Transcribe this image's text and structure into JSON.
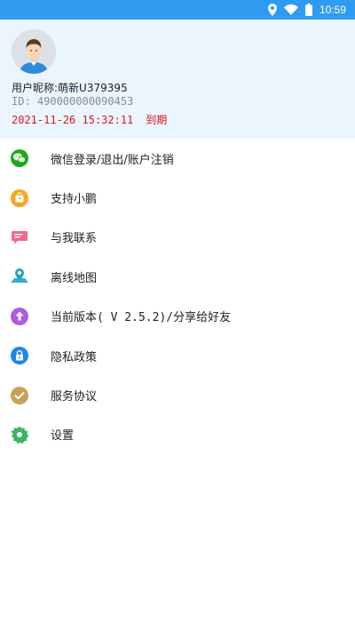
{
  "status_bar": {
    "time": "10:59",
    "color": "#2f9bf0"
  },
  "profile": {
    "nickname_label": "用户昵称:",
    "nickname": "萌新U379395",
    "id_text": "ID: 490000000090453",
    "expire_date": "2021-11-26 15:32:11",
    "expire_status": "到期"
  },
  "menu": [
    {
      "label": "微信登录/退出/账户注销",
      "icon": "wechat-icon",
      "color": "#1aad19"
    },
    {
      "label": "支持小鹏",
      "icon": "gift-bag-icon",
      "color": "#f5a623"
    },
    {
      "label": "与我联系",
      "icon": "message-icon",
      "color": "#f06a8a"
    },
    {
      "label": "离线地图",
      "icon": "map-location-icon",
      "color": "#2fb4c8"
    },
    {
      "label": "当前版本( V 2.5.2)/分享给好友",
      "icon": "upgrade-arrow-icon",
      "color": "#b05ae0"
    },
    {
      "label": "隐私政策",
      "icon": "lock-icon",
      "color": "#1e88e5"
    },
    {
      "label": "服务协议",
      "icon": "check-circle-icon",
      "color": "#c7a15a"
    },
    {
      "label": "设置",
      "icon": "gear-icon",
      "color": "#3cb563"
    }
  ]
}
